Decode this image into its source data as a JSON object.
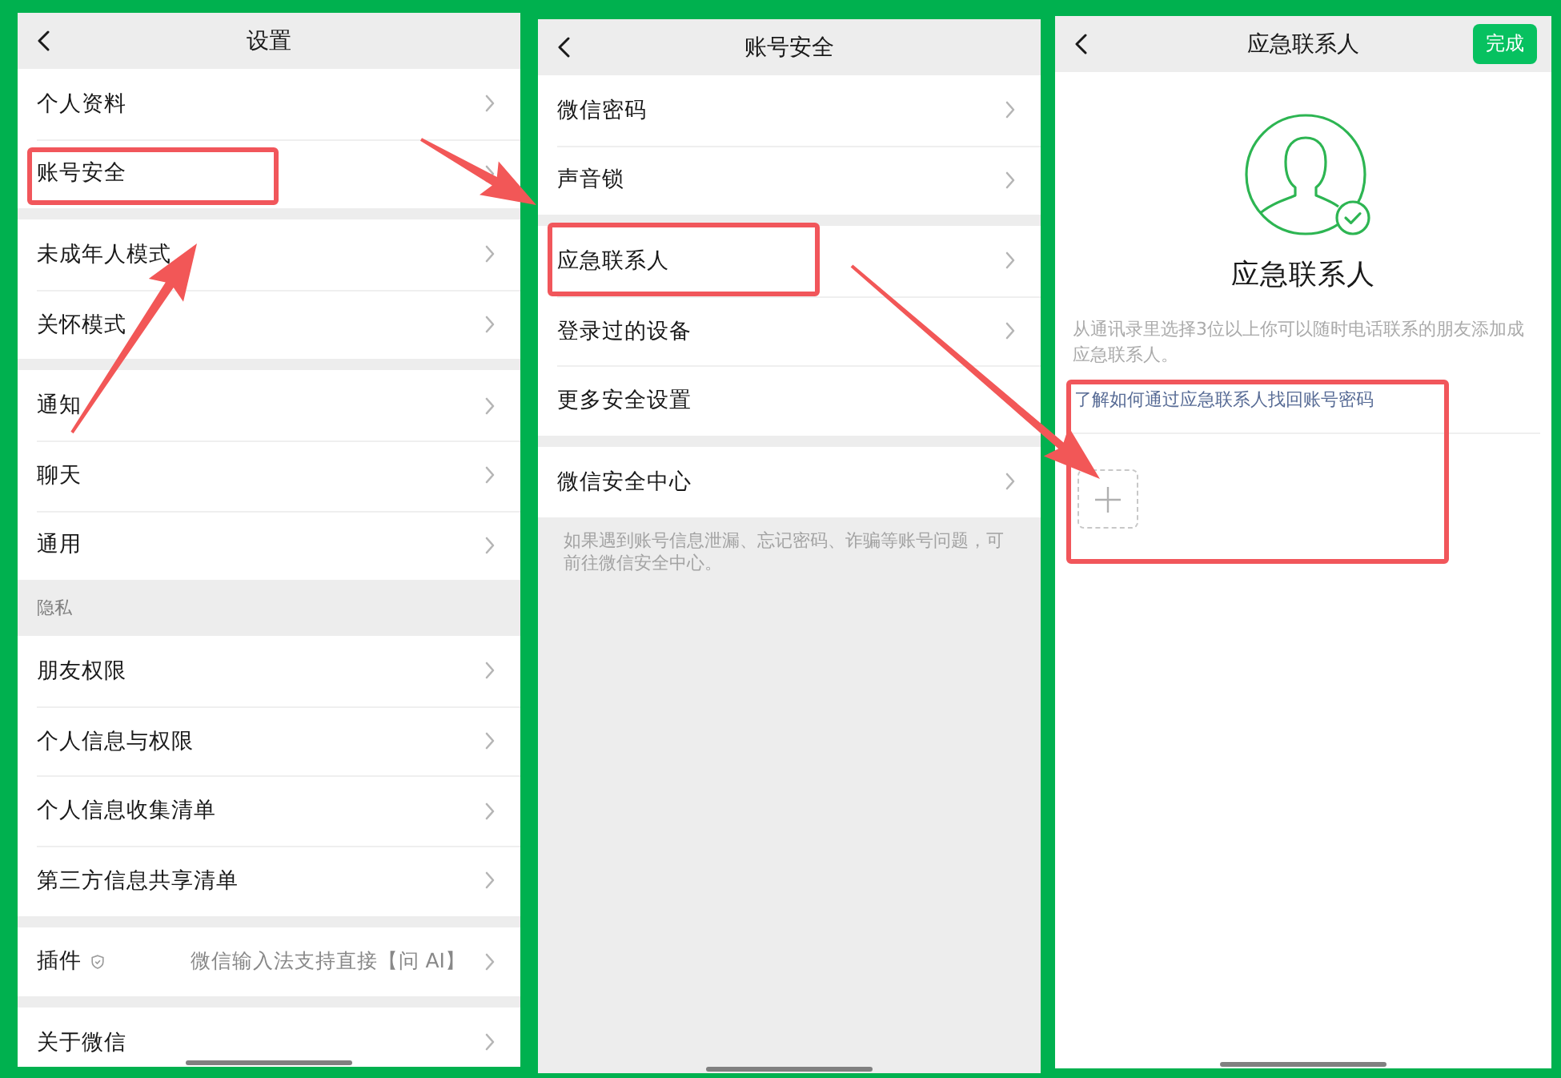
{
  "screens": [
    {
      "kind": "list",
      "title": "设置",
      "sections": [
        {
          "items": [
            {
              "kind": "nav",
              "label": "个人资料",
              "highlighted": false
            },
            {
              "kind": "nav",
              "label": "账号安全",
              "highlighted": true
            }
          ]
        },
        {
          "items": [
            {
              "kind": "nav",
              "label": "未成年人模式",
              "highlighted": false
            },
            {
              "kind": "nav",
              "label": "关怀模式",
              "highlighted": false
            }
          ]
        },
        {
          "items": [
            {
              "kind": "nav",
              "label": "通知",
              "highlighted": false
            },
            {
              "kind": "nav",
              "label": "聊天",
              "highlighted": false
            },
            {
              "kind": "nav",
              "label": "通用",
              "highlighted": false
            }
          ]
        },
        {
          "header": "隐私",
          "items": [
            {
              "kind": "nav",
              "label": "朋友权限",
              "highlighted": false
            },
            {
              "kind": "nav",
              "label": "个人信息与权限",
              "highlighted": false
            },
            {
              "kind": "nav",
              "label": "个人信息收集清单",
              "highlighted": false
            },
            {
              "kind": "nav",
              "label": "第三方信息共享清单",
              "highlighted": false
            }
          ]
        },
        {
          "items": [
            {
              "kind": "plugin",
              "label": "插件",
              "value": "微信输入法支持直接【问 AI】",
              "highlighted": false
            }
          ]
        },
        {
          "items": [
            {
              "kind": "nav",
              "label": "关于微信",
              "highlighted": false
            }
          ]
        }
      ]
    },
    {
      "kind": "list",
      "title": "账号安全",
      "sections": [
        {
          "items": [
            {
              "kind": "nav",
              "label": "微信密码",
              "highlighted": false
            },
            {
              "kind": "nav",
              "label": "声音锁",
              "highlighted": false
            }
          ]
        },
        {
          "items": [
            {
              "kind": "nav",
              "label": "应急联系人",
              "highlighted": true
            },
            {
              "kind": "nav",
              "label": "登录过的设备",
              "highlighted": false
            },
            {
              "kind": "plain",
              "label": "更多安全设置",
              "highlighted": false
            }
          ]
        },
        {
          "items": [
            {
              "kind": "nav",
              "label": "微信安全中心",
              "highlighted": false
            }
          ]
        }
      ],
      "footer": "如果遇到账号信息泄漏、忘记密码、诈骗等账号问题，可前往微信安全中心。"
    },
    {
      "kind": "contact",
      "title": "应急联系人",
      "done_button": "完成",
      "heading": "应急联系人",
      "description": "从通讯录里选择3位以上你可以随时电话联系的朋友添加成应急联系人。",
      "help": {
        "link": "了解如何通过应急联系人找回账号密码",
        "highlighted": true
      }
    }
  ]
}
